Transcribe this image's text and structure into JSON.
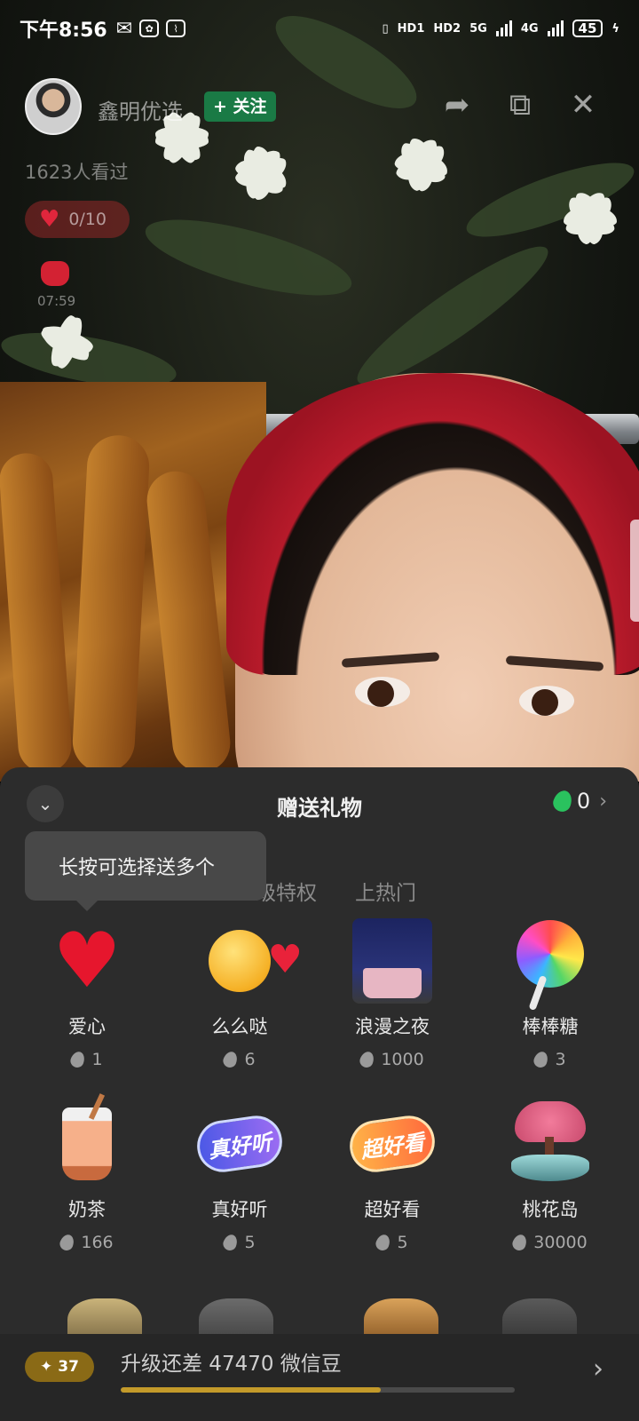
{
  "status_bar": {
    "time": "下午8:56",
    "network_labels": [
      "HD1",
      "HD2",
      "5G",
      "4G"
    ],
    "battery": "45"
  },
  "live": {
    "host_name": "鑫明优选",
    "follow_label": "+ 关注",
    "viewers": "1623人看过",
    "likes": "0/10",
    "red_packet_time": "07:59"
  },
  "gift_panel": {
    "title": "赠送礼物",
    "balance": "0",
    "tooltip": "长按可选择送多个",
    "tabs": [
      "级特权",
      "上热门"
    ],
    "gifts": [
      {
        "name": "爱心",
        "price": "1",
        "icon": "heart-icon"
      },
      {
        "name": "么么哒",
        "price": "6",
        "icon": "kiss-emoji-icon"
      },
      {
        "name": "浪漫之夜",
        "price": "1000",
        "icon": "romantic-dinner-icon"
      },
      {
        "name": "棒棒糖",
        "price": "3",
        "icon": "lollipop-icon"
      },
      {
        "name": "奶茶",
        "price": "166",
        "icon": "milk-tea-icon"
      },
      {
        "name": "真好听",
        "price": "5",
        "icon": "sounds-good-badge-icon"
      },
      {
        "name": "超好看",
        "price": "5",
        "icon": "looks-great-badge-icon"
      },
      {
        "name": "桃花岛",
        "price": "30000",
        "icon": "peach-blossom-island-icon"
      }
    ],
    "badge_texts": {
      "listen": "真好听",
      "look": "超好看"
    },
    "level": {
      "badge": "37",
      "text": "升级还差 47470 微信豆",
      "progress_fraction": 0.66
    }
  },
  "colors": {
    "panel_bg": "#2c2c2c",
    "follow_green": "#1a7a45",
    "balance_bean": "#2ac25e",
    "level_gold": "#c39a2a"
  }
}
